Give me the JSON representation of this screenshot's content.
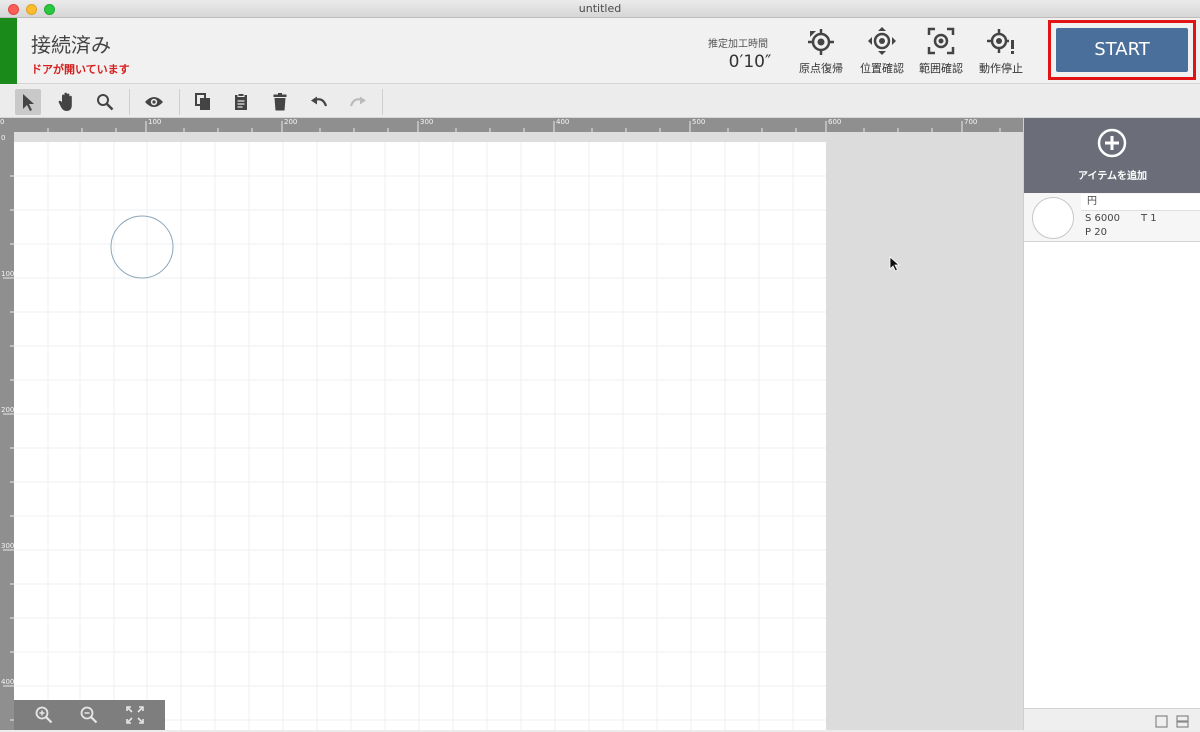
{
  "window": {
    "title": "untitled"
  },
  "header": {
    "connection_status": "接続済み",
    "door_warning": "ドアが開いています",
    "estimate_label": "推定加工時間",
    "estimate_value": "0′10″",
    "buttons": [
      {
        "label": "原点復帰",
        "icon": "origin-return-icon"
      },
      {
        "label": "位置確認",
        "icon": "position-check-icon"
      },
      {
        "label": "範囲確認",
        "icon": "range-check-icon"
      },
      {
        "label": "動作停止",
        "icon": "stop-operation-icon"
      }
    ],
    "start_label": "START"
  },
  "toolbar": {
    "tools": [
      "select-arrow-icon",
      "hand-pan-icon",
      "zoom-search-icon",
      "preview-eye-icon",
      "copy-icon",
      "paste-clipboard-icon",
      "delete-trash-icon",
      "undo-icon",
      "redo-icon"
    ]
  },
  "ruler": {
    "top_ticks": [
      "0",
      "100",
      "200",
      "300",
      "400",
      "500",
      "600",
      "700"
    ],
    "left_ticks": [
      "0",
      "100",
      "200",
      "300",
      "400"
    ]
  },
  "canvas": {
    "zoom_buttons": [
      "zoom-in-icon",
      "zoom-out-icon",
      "fit-screen-icon"
    ]
  },
  "side_panel": {
    "add_item_label": "アイテムを追加",
    "items": [
      {
        "name": "円",
        "speed": "S 6000",
        "times": "T 1",
        "power": "P 20"
      }
    ]
  },
  "colors": {
    "connected": "#1a8a1a",
    "warning": "#d51f1f",
    "start_button": "#4a6f9a",
    "highlight": "#e01414",
    "panel_header": "#6b6e78"
  }
}
